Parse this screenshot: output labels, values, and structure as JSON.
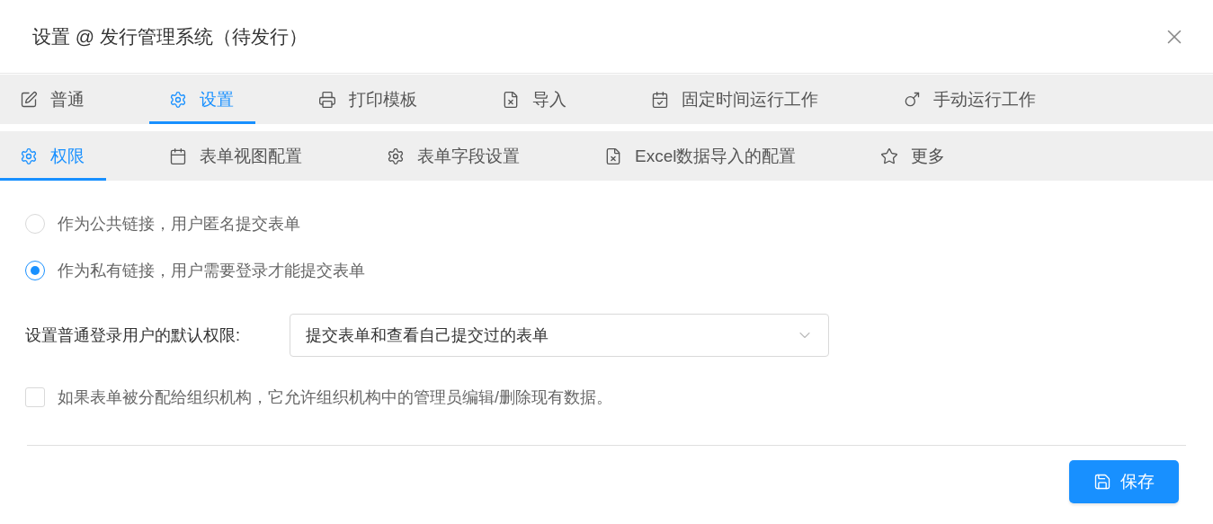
{
  "dialog": {
    "title": "设置 @ 发行管理系统（待发行）"
  },
  "tabs": [
    {
      "label": "普通",
      "selected": false
    },
    {
      "label": "设置",
      "selected": true
    },
    {
      "label": "打印模板",
      "selected": false
    },
    {
      "label": "导入",
      "selected": false
    },
    {
      "label": "固定时间运行工作",
      "selected": false
    },
    {
      "label": "手动运行工作",
      "selected": false
    }
  ],
  "subtabs": [
    {
      "label": "权限",
      "selected": true
    },
    {
      "label": "表单视图配置",
      "selected": false
    },
    {
      "label": "表单字段设置",
      "selected": false
    },
    {
      "label": "Excel数据导入的配置",
      "selected": false
    },
    {
      "label": "更多",
      "selected": false
    }
  ],
  "access_options": [
    {
      "label": "作为公共链接，用户匿名提交表单",
      "selected": false
    },
    {
      "label": "作为私有链接，用户需要登录才能提交表单",
      "selected": true
    }
  ],
  "default_permission": {
    "label": "设置普通登录用户的默认权限:",
    "value": "提交表单和查看自己提交过的表单"
  },
  "org_admin_option": {
    "label": "如果表单被分配给组织机构，它允许组织机构中的管理员编辑/删除现有数据。",
    "checked": false
  },
  "save_button": {
    "label": "保存"
  }
}
